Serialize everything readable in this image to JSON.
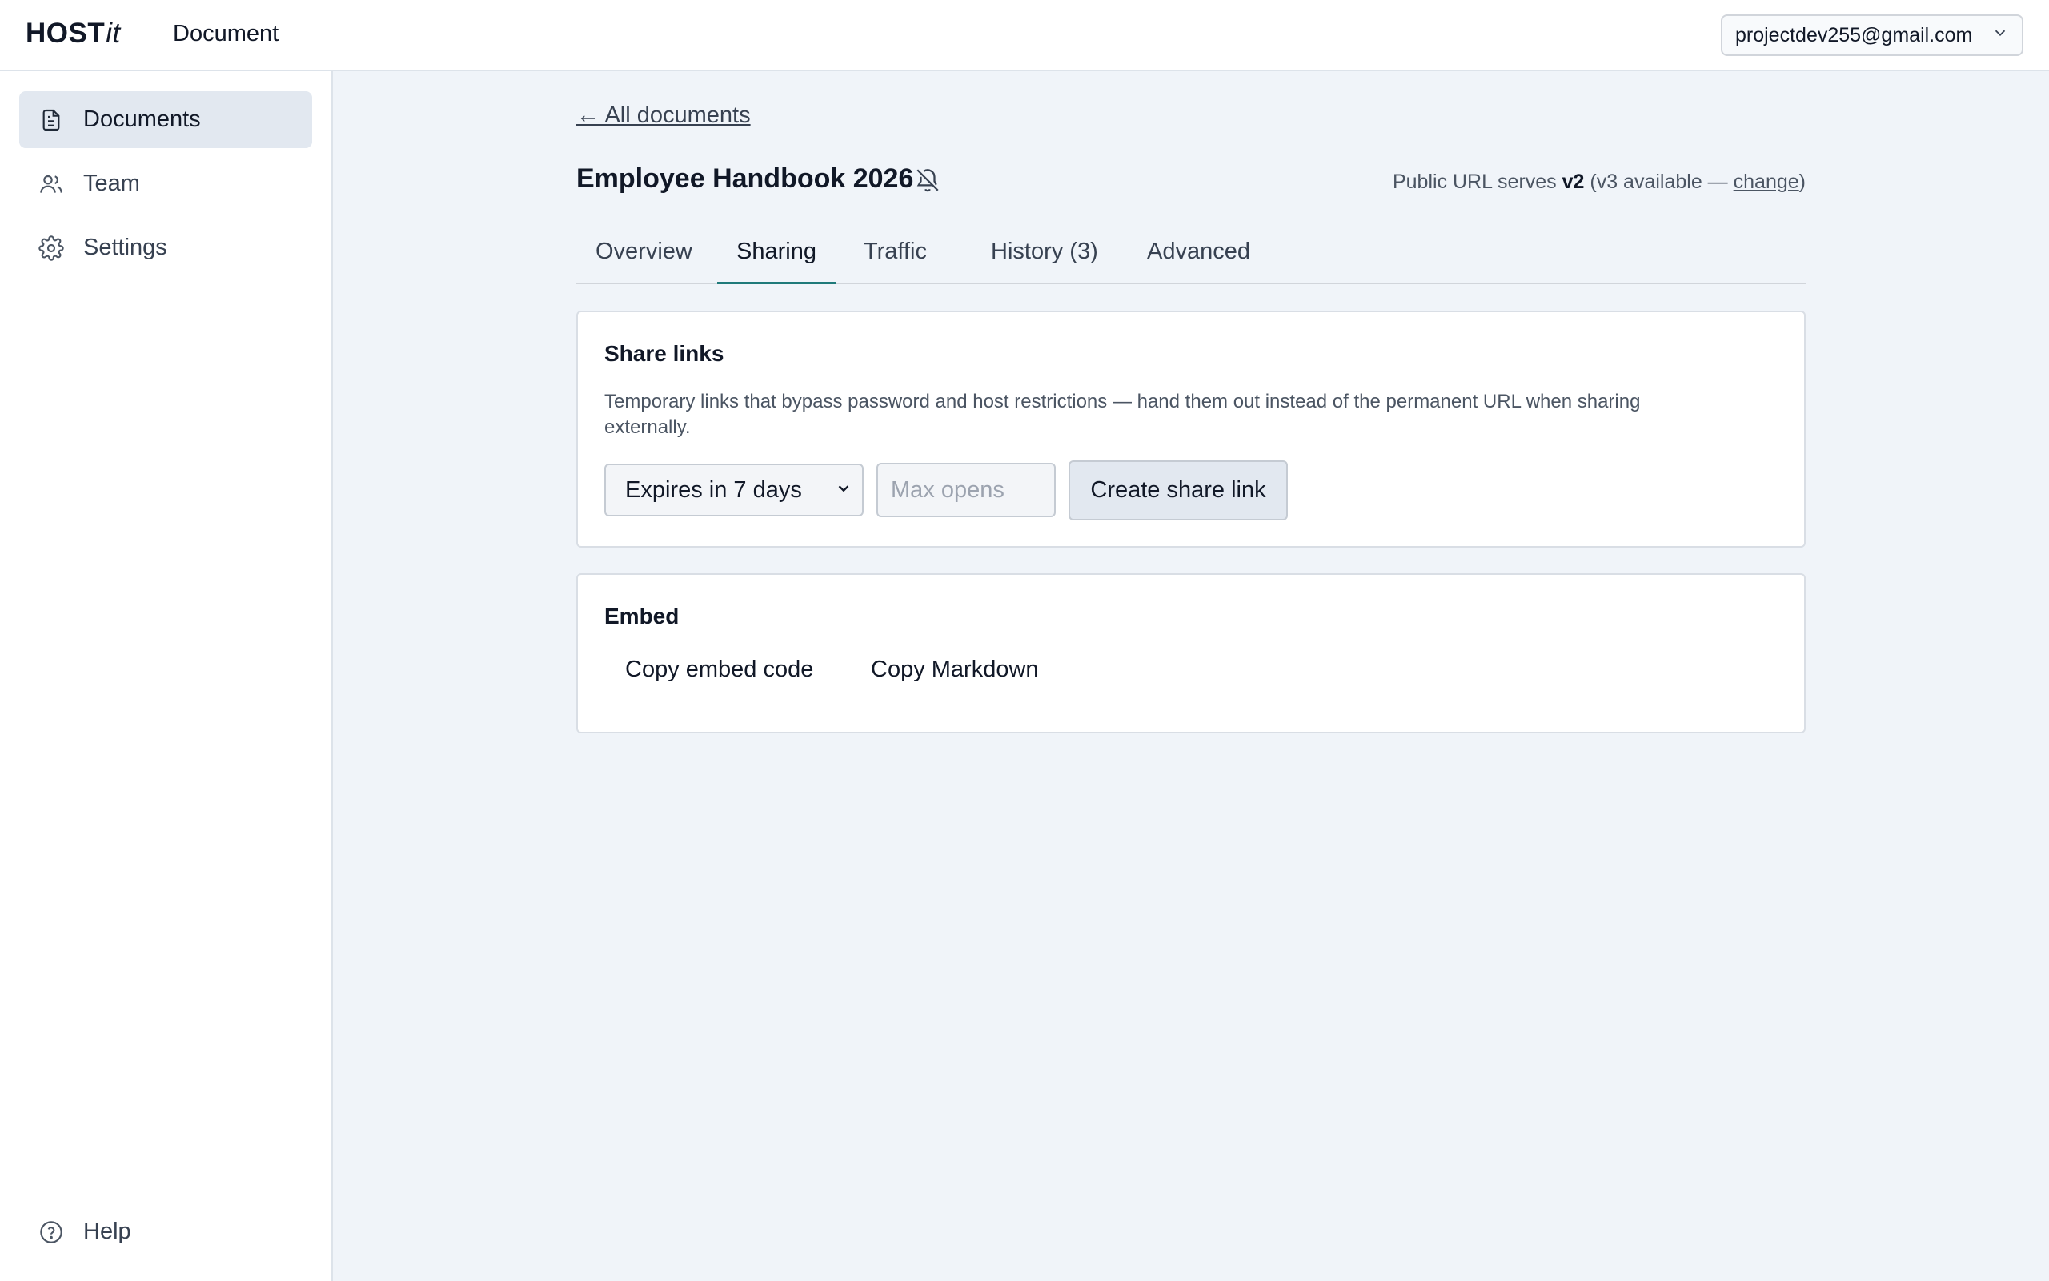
{
  "app": {
    "brand": "HOST",
    "brand_suffix": "it",
    "section_title": "Document",
    "account_email": "projectdev255@gmail.com"
  },
  "sidebar": {
    "items": [
      {
        "label": "Documents",
        "icon": "document-icon",
        "active": true
      },
      {
        "label": "Team",
        "icon": "users-icon",
        "active": false
      },
      {
        "label": "Settings",
        "icon": "gear-icon",
        "active": false
      }
    ],
    "help_label": "Help"
  },
  "main": {
    "back_link": "← All documents",
    "doc_title": "Employee Handbook 2026",
    "public_url": {
      "prefix": "Public URL serves ",
      "version": "v2",
      "middle": " (v3 available — ",
      "change": "change",
      "suffix": ")"
    },
    "tabs": [
      {
        "label": "Overview",
        "active": false
      },
      {
        "label": "Sharing",
        "active": true
      },
      {
        "label": "Traffic",
        "active": false
      },
      {
        "label": "History (3)",
        "active": false
      },
      {
        "label": "Advanced",
        "active": false
      }
    ]
  },
  "share_links": {
    "title": "Share links",
    "description": "Temporary links that bypass password and host restrictions — hand them out instead of the permanent URL when sharing externally.",
    "expiry_selected": "Expires in 7 days",
    "max_opens_placeholder": "Max opens",
    "create_button": "Create share link"
  },
  "embed": {
    "title": "Embed",
    "copy_embed_code": "Copy embed code",
    "copy_markdown": "Copy Markdown"
  },
  "colors": {
    "accent": "#1f7a7a",
    "background": "#f0f4f9",
    "active_nav": "#e2e8f0"
  }
}
